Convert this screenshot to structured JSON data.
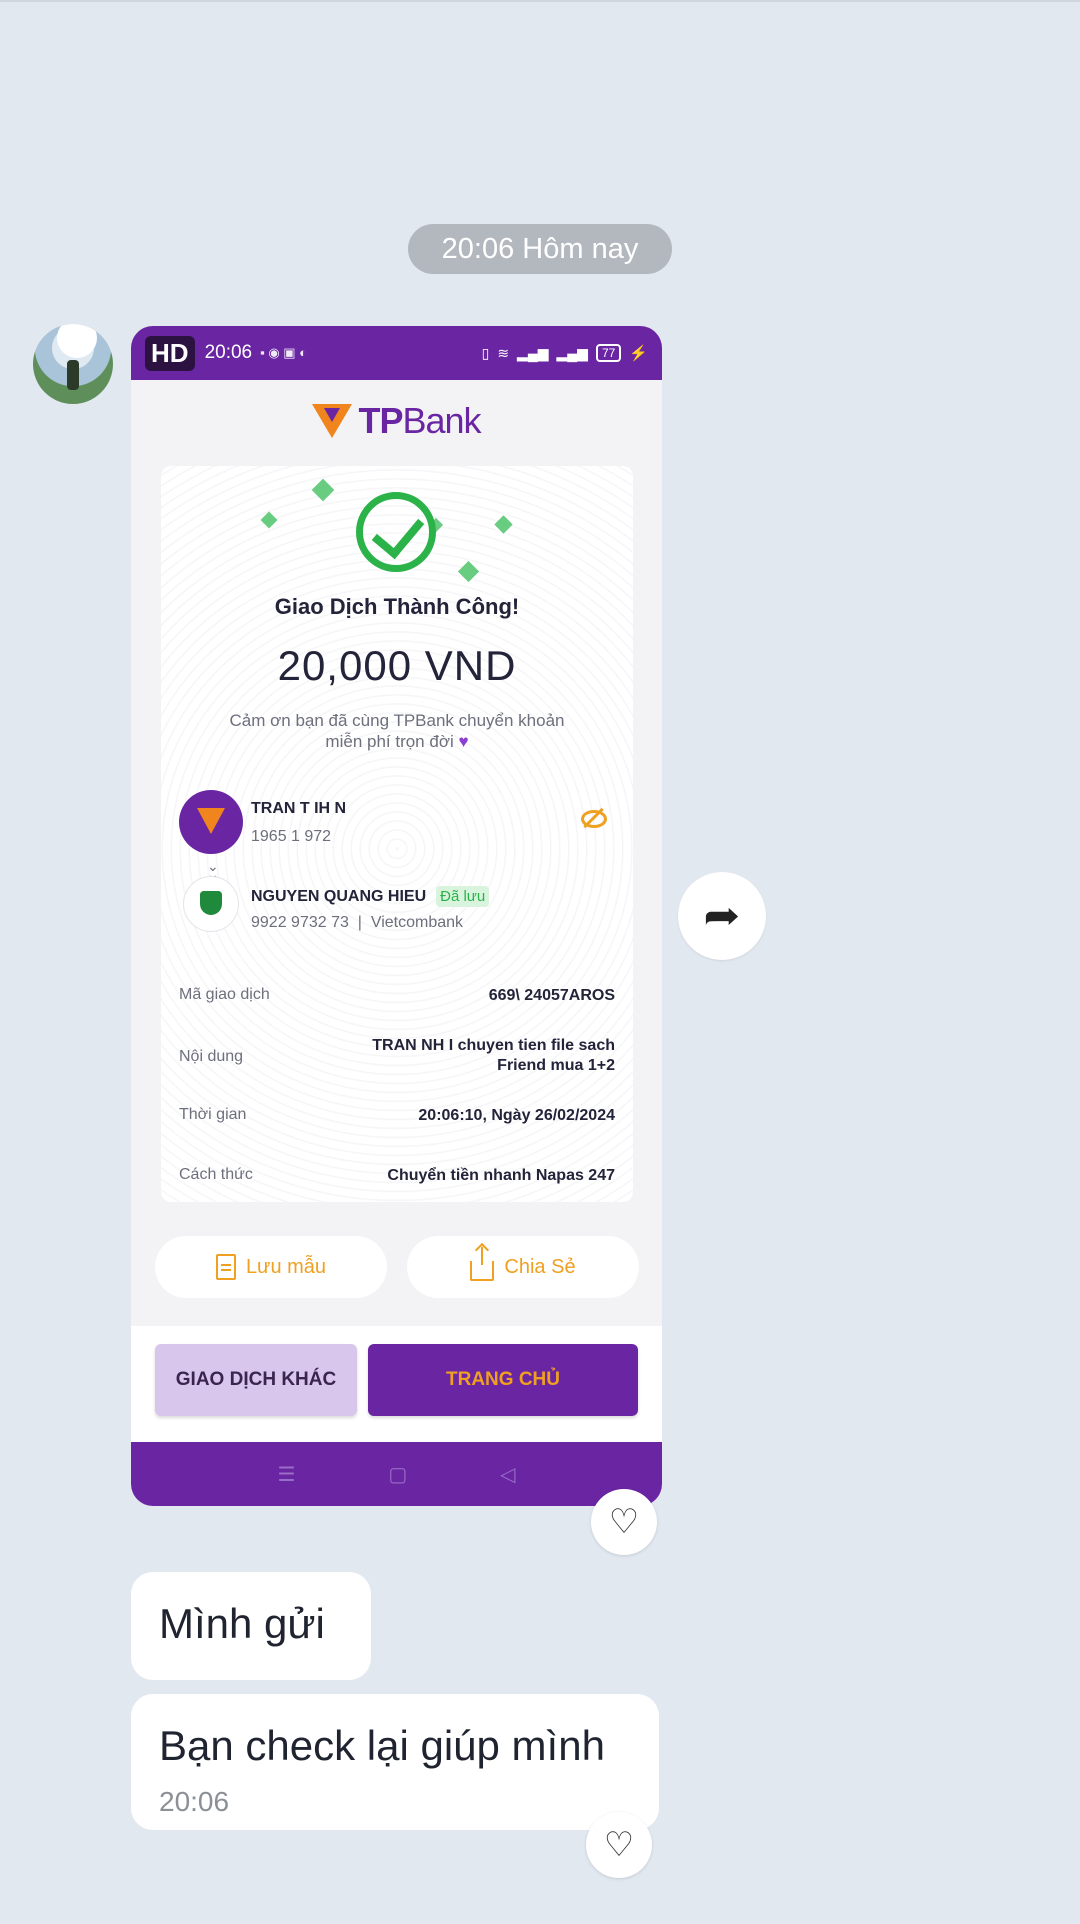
{
  "chat": {
    "date_chip": "20:06 Hôm nay",
    "messages": [
      {
        "text": "Mình gửi"
      },
      {
        "text": "Bạn check lại giúp mình",
        "time": "20:06"
      }
    ]
  },
  "shot": {
    "statusbar": {
      "hd": "HD",
      "time": "20:06",
      "battery": "77"
    },
    "logo": {
      "tp": "TP",
      "bank": "Bank"
    },
    "receipt": {
      "title": "Giao Dịch Thành Công!",
      "amount": "20,000 VND",
      "thanks_line1": "Cảm ơn bạn đã cùng TPBank chuyển khoản",
      "thanks_line2": "miễn phí trọn đời",
      "sender": {
        "name": "TRAN T      IH     N",
        "account": "1965        1 972"
      },
      "receiver": {
        "name": "NGUYEN QUANG HIEU",
        "badge": "Đã lưu",
        "account": "9922 9732 73",
        "bank": "Vietcombank"
      },
      "rows": [
        {
          "label": "Mã giao dịch",
          "value": "669\\      24057AROS"
        },
        {
          "label": "Nội dung",
          "value": "TRAN          NH       I chuyen tien file sach",
          "value2": "Friend mua 1+2"
        },
        {
          "label": "Thời gian",
          "value": "20:06:10, Ngày 26/02/2024"
        },
        {
          "label": "Cách thức",
          "value": "Chuyển tiền nhanh Napas 247"
        }
      ]
    },
    "buttons": {
      "save_template": "Lưu mẫu",
      "share": "Chia Sẻ",
      "other": "GIAO DỊCH KHÁC",
      "home": "TRANG CHỦ"
    }
  },
  "colors": {
    "purple": "#6a25a3",
    "orange": "#f0a020",
    "green": "#2bb34a",
    "bg": "#e2e8f0"
  },
  "icons": [
    "share-arrow-icon",
    "heart-icon",
    "check-circle-icon",
    "eye-off-icon",
    "document-icon",
    "upload-icon"
  ]
}
